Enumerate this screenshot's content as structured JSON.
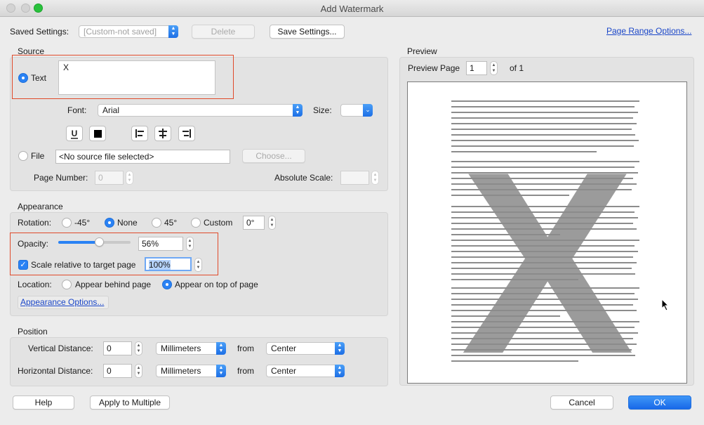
{
  "window": {
    "title": "Add Watermark"
  },
  "saved_settings": {
    "label": "Saved Settings:",
    "value": "[Custom-not saved]",
    "delete_label": "Delete",
    "save_label": "Save Settings...",
    "page_range_link": "Page Range Options..."
  },
  "source": {
    "section_label": "Source",
    "text_radio_label": "Text",
    "text_value": "X",
    "font_label": "Font:",
    "font_value": "Arial",
    "size_label": "Size:",
    "size_value": "",
    "file_radio_label": "File",
    "file_value": "<No source file selected>",
    "choose_label": "Choose...",
    "page_number_label": "Page Number:",
    "page_number_value": "0",
    "absolute_scale_label": "Absolute Scale:",
    "absolute_scale_value": ""
  },
  "appearance": {
    "section_label": "Appearance",
    "rotation_label": "Rotation:",
    "rotation_options": [
      "-45°",
      "None",
      "45°",
      "Custom"
    ],
    "rotation_selected": "None",
    "rotation_custom_value": "0°",
    "opacity_label": "Opacity:",
    "opacity_value": "56%",
    "opacity_fraction": 0.56,
    "scale_label": "Scale relative to target page",
    "scale_value": "100%",
    "location_label": "Location:",
    "location_behind": "Appear behind page",
    "location_on_top": "Appear on top of page",
    "location_selected": "Appear on top of page",
    "options_link": "Appearance Options..."
  },
  "position": {
    "section_label": "Position",
    "vertical_label": "Vertical Distance:",
    "vertical_value": "0",
    "vertical_unit": "Millimeters",
    "vertical_from_label": "from",
    "vertical_from": "Center",
    "horizontal_label": "Horizontal Distance:",
    "horizontal_value": "0",
    "horizontal_unit": "Millimeters",
    "horizontal_from_label": "from",
    "horizontal_from": "Center"
  },
  "preview": {
    "section_label": "Preview",
    "page_label": "Preview Page",
    "page_value": "1",
    "of_label": "of 1"
  },
  "footer": {
    "help_label": "Help",
    "apply_multiple_label": "Apply to Multiple",
    "cancel_label": "Cancel",
    "ok_label": "OK"
  },
  "colors": {
    "accent": "#2a82f4",
    "highlight_box": "#e04a2a",
    "link": "#1a46c8",
    "watermark": "#8a8a8a"
  }
}
